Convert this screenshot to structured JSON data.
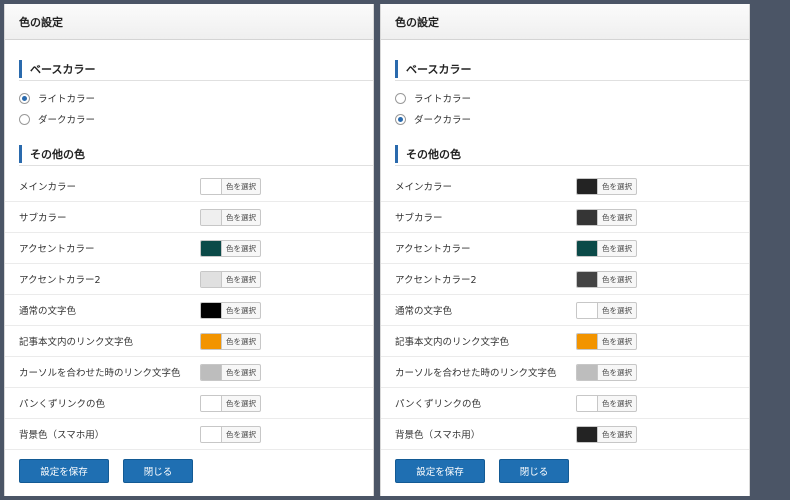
{
  "panels": [
    {
      "title": "色の設定",
      "base_section": "ベースカラー",
      "radio": [
        {
          "label": "ライトカラー",
          "checked": true
        },
        {
          "label": "ダークカラー",
          "checked": false
        }
      ],
      "other_section": "その他の色",
      "rows": [
        {
          "label": "メインカラー",
          "color": "#ffffff"
        },
        {
          "label": "サブカラー",
          "color": "#efefef"
        },
        {
          "label": "アクセントカラー",
          "color": "#0b4a48"
        },
        {
          "label": "アクセントカラー2",
          "color": "#e0e0e0"
        },
        {
          "label": "通常の文字色",
          "color": "#000000"
        },
        {
          "label": "記事本文内のリンク文字色",
          "color": "#f29400"
        },
        {
          "label": "カーソルを合わせた時のリンク文字色",
          "color": "#bdbdbd"
        },
        {
          "label": "パンくずリンクの色",
          "color": "#ffffff"
        },
        {
          "label": "背景色（スマホ用）",
          "color": "#ffffff"
        }
      ],
      "picker_label": "色を選択",
      "save_label": "設定を保存",
      "close_label": "閉じる"
    },
    {
      "title": "色の設定",
      "base_section": "ベースカラー",
      "radio": [
        {
          "label": "ライトカラー",
          "checked": false
        },
        {
          "label": "ダークカラー",
          "checked": true
        }
      ],
      "other_section": "その他の色",
      "rows": [
        {
          "label": "メインカラー",
          "color": "#232323"
        },
        {
          "label": "サブカラー",
          "color": "#353535"
        },
        {
          "label": "アクセントカラー",
          "color": "#0b4a48"
        },
        {
          "label": "アクセントカラー2",
          "color": "#444444"
        },
        {
          "label": "通常の文字色",
          "color": "#ffffff"
        },
        {
          "label": "記事本文内のリンク文字色",
          "color": "#f29400"
        },
        {
          "label": "カーソルを合わせた時のリンク文字色",
          "color": "#bdbdbd"
        },
        {
          "label": "パンくずリンクの色",
          "color": "#ffffff"
        },
        {
          "label": "背景色（スマホ用）",
          "color": "#232323"
        }
      ],
      "picker_label": "色を選択",
      "save_label": "設定を保存",
      "close_label": "閉じる"
    }
  ]
}
